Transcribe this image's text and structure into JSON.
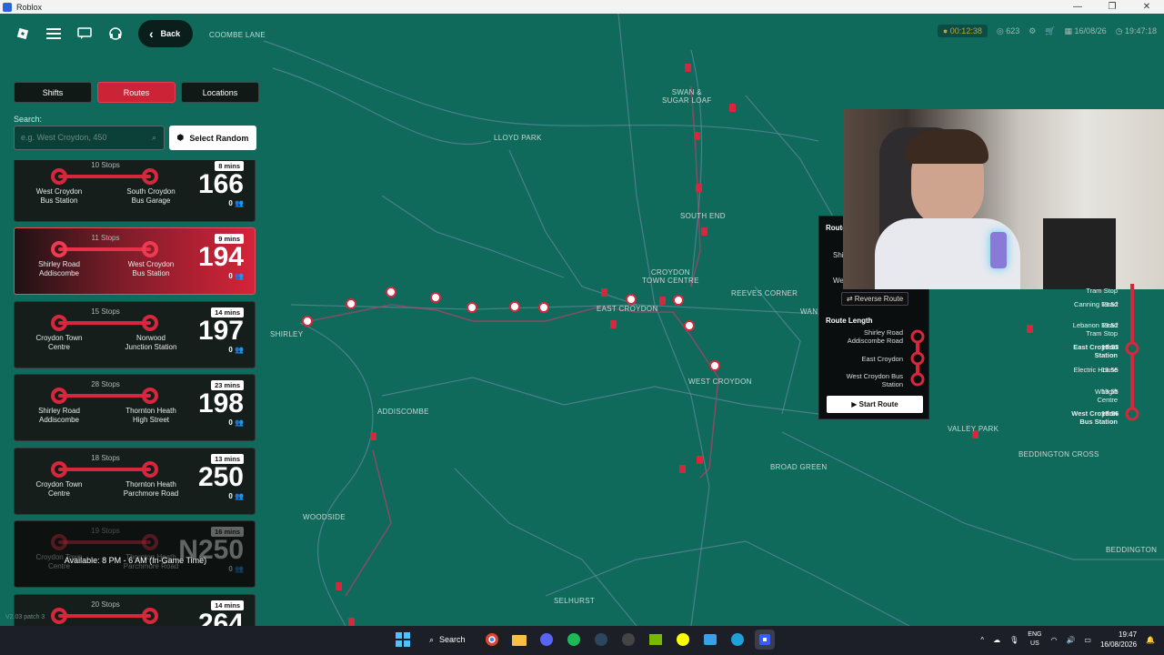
{
  "window": {
    "title": "Roblox",
    "controls": [
      "—",
      "❐",
      "✕"
    ]
  },
  "topbar": {
    "back_label": "Back"
  },
  "hud": {
    "timer": "00:12:38",
    "coins": "623",
    "date": "16/08/26",
    "clock": "19:47:18"
  },
  "tabs": [
    {
      "label": "Shifts",
      "active": false
    },
    {
      "label": "Routes",
      "active": true
    },
    {
      "label": "Locations",
      "active": false
    }
  ],
  "search": {
    "label": "Search:",
    "placeholder": "e.g. West Croydon, 450",
    "random_label": "Select Random"
  },
  "routes": [
    {
      "stops": "10 Stops",
      "from": "West Croydon\nBus Station",
      "to": "South Croydon\nBus Garage",
      "mins": "8 mins",
      "number": "166",
      "passengers": "0",
      "state": "normal"
    },
    {
      "stops": "11 Stops",
      "from": "Shirley Road\nAddiscombe",
      "to": "West Croydon\nBus Station",
      "mins": "9 mins",
      "number": "194",
      "passengers": "0",
      "state": "active"
    },
    {
      "stops": "15 Stops",
      "from": "Croydon Town\nCentre",
      "to": "Norwood\nJunction Station",
      "mins": "14 mins",
      "number": "197",
      "passengers": "0",
      "state": "normal"
    },
    {
      "stops": "28 Stops",
      "from": "Shirley Road\nAddiscombe",
      "to": "Thornton Heath\nHigh Street",
      "mins": "23 mins",
      "number": "198",
      "passengers": "0",
      "state": "normal"
    },
    {
      "stops": "18 Stops",
      "from": "Croydon Town\nCentre",
      "to": "Thornton Heath\nParchmore Road",
      "mins": "13 mins",
      "number": "250",
      "passengers": "0",
      "state": "normal"
    },
    {
      "stops": "19 Stops",
      "from": "Croydon Town\nCentre",
      "to": "Thornton Heath\nParchmore Road",
      "mins": "16 mins",
      "number": "N250",
      "passengers": "0",
      "state": "disabled",
      "availability": "Available: 8 PM - 6 AM (In-Game Time)"
    },
    {
      "stops": "20 Stops",
      "from": "",
      "to": "",
      "mins": "14 mins",
      "number": "264",
      "passengers": "0",
      "state": "normal"
    }
  ],
  "version": "V2.03 patch 3",
  "route_panel": {
    "title": "Route",
    "reverse_label": "Reverse Route",
    "length_label": "Route Length",
    "stops": [
      "Shirley Road\nAddiscombe Road",
      "East Croydon",
      "West Croydon Bus\nStation"
    ],
    "start_label": "Start Route",
    "partial_1": "Shirl",
    "partial_2": "We"
  },
  "timetable": [
    {
      "name": "Tram Stop",
      "time": "",
      "bold": false
    },
    {
      "name": "Canning Road",
      "time": "19:52",
      "bold": false
    },
    {
      "name": "Lebanon Road\nTram Stop",
      "time": "19:52",
      "bold": false
    },
    {
      "name": "East Croydon\nStation",
      "time": "19:53",
      "bold": true
    },
    {
      "name": "Electric House",
      "time": "19:55",
      "bold": false
    },
    {
      "name": "Whitgift\nCentre",
      "time": "19:55",
      "bold": false
    },
    {
      "name": "West Croydon\nBus Station",
      "time": "19:56",
      "bold": true
    }
  ],
  "map_labels": [
    {
      "text": "COOMBE LANE"
    },
    {
      "text": "SWAN &\nSUGAR LOAF"
    },
    {
      "text": "LLOYD PARK"
    },
    {
      "text": "SOUTH END"
    },
    {
      "text": "CROYDON\nTOWN CENTRE"
    },
    {
      "text": "REEVES CORNER"
    },
    {
      "text": "EAST CROYDON"
    },
    {
      "text": "SHIRLEY"
    },
    {
      "text": "WEST CROYDON"
    },
    {
      "text": "ADDISCOMBE"
    },
    {
      "text": "BROAD GREEN"
    },
    {
      "text": "WOODSIDE"
    },
    {
      "text": "SELHURST"
    },
    {
      "text": "VALLEY PARK"
    },
    {
      "text": "BEDDINGTON CROSS"
    },
    {
      "text": "BEDDINGTON"
    },
    {
      "text": "WAN"
    }
  ],
  "taskbar": {
    "search_label": "Search",
    "lang_line1": "ENG",
    "lang_line2": "US",
    "time": "19:47",
    "date": "16/08/2026"
  },
  "colors": {
    "accent": "#d8263c",
    "map": "#0f6a5c",
    "panel": "#161e1c"
  }
}
